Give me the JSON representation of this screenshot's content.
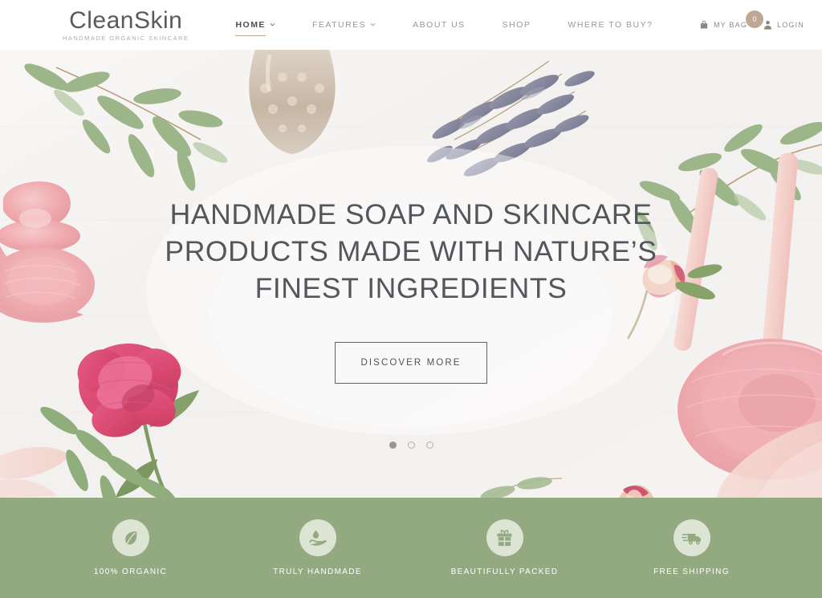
{
  "header": {
    "brand": {
      "name": "CleanSkin",
      "tagline": "HANDMADE ORGANIC SKINCARE"
    },
    "nav": [
      {
        "label": "HOME",
        "icon": "chevron-down-icon",
        "has_caret": true,
        "active": true
      },
      {
        "label": "FEATURES",
        "icon": "chevron-down-icon",
        "has_caret": true,
        "active": false
      },
      {
        "label": "ABOUT US",
        "has_caret": false,
        "active": false
      },
      {
        "label": "SHOP",
        "has_caret": false,
        "active": false
      },
      {
        "label": "WHERE TO BUY?",
        "has_caret": false,
        "active": false
      }
    ],
    "cart": {
      "label": "MY BAG",
      "icon": "shopping-bag-icon",
      "count": "0"
    },
    "account": {
      "label": "LOGIN",
      "icon": "user-icon"
    }
  },
  "hero": {
    "title": "HANDMADE SOAP AND SKINCARE PRODUCTS MADE WITH NATURE’S FINEST INGREDIENTS",
    "cta_label": "DISCOVER MORE",
    "slides": [
      {
        "active": true
      },
      {
        "active": false
      },
      {
        "active": false
      }
    ]
  },
  "features": [
    {
      "label": "100% ORGANIC",
      "icon": "leaf-icon"
    },
    {
      "label": "TRULY HANDMADE",
      "icon": "hand-drop-icon"
    },
    {
      "label": "BEAUTIFULLY PACKED",
      "icon": "gift-box-icon"
    },
    {
      "label": "FREE SHIPPING",
      "icon": "delivery-truck-icon"
    }
  ],
  "colors": {
    "brand_text": "#5a5a5a",
    "nav_inactive": "#9b9790",
    "nav_active": "#4d4d4d",
    "nav_underline": "#b8a48f",
    "cart_badge": "#bfa893",
    "hero_title": "#53565a",
    "feature_bar": "#93a97f",
    "feature_circle": "#dde4d3",
    "feature_icon": "#93a97f",
    "feature_label": "#ffffff"
  }
}
